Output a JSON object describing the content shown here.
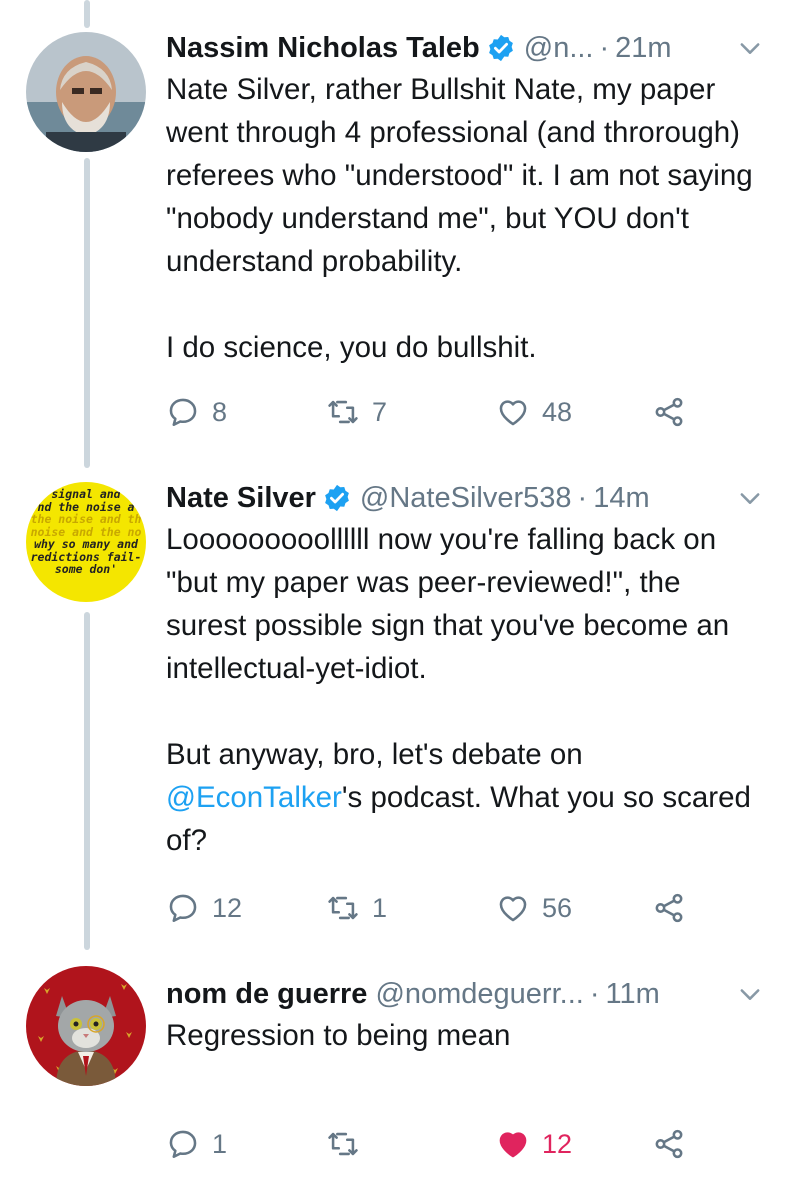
{
  "tweets": [
    {
      "name": "Nassim Nicholas Taleb",
      "handle": "@n...",
      "time": "21m",
      "paragraphs": [
        "Nate Silver, rather Bullshit Nate, my paper went through 4 professional (and throrough) referees who \"understood\" it. I am not saying \"nobody understand me\", but YOU don't understand probability.",
        "I do science, you do bullshit."
      ],
      "replies": "8",
      "retweets": "7",
      "likes": "48"
    },
    {
      "name": "Nate Silver",
      "handle": "@NateSilver538",
      "time": "14m",
      "para1": "Looooooooollllll now you're falling back on \"but my paper was peer-reviewed!\", the surest possible sign that you've become an intellectual-yet-idiot.",
      "para2_start": "But anyway, bro, let's debate on",
      "mention": "@EconTalker",
      "para2_end": "'s podcast. What you so scared of?",
      "replies": "12",
      "retweets": "1",
      "likes": "56",
      "avatar_text": [
        "signal and",
        "nd the noise a",
        "the noise and th",
        "noise and the no",
        "why so many and",
        "redictions fail-",
        "some don'"
      ]
    },
    {
      "name": "nom de guerre",
      "handle": "@nomdeguerr...",
      "time": "11m",
      "text": "Regression to being mean",
      "replies": "1",
      "retweets": "",
      "likes": "12"
    }
  ],
  "colors": {
    "text": "#14171a",
    "secondary": "#657786",
    "link": "#1da1f2",
    "like": "#e0245e",
    "thread_line": "#ccd6dd"
  },
  "icons": [
    "reply-icon",
    "retweet-icon",
    "heart-icon",
    "share-icon",
    "verified-icon",
    "chevron-down-icon"
  ]
}
